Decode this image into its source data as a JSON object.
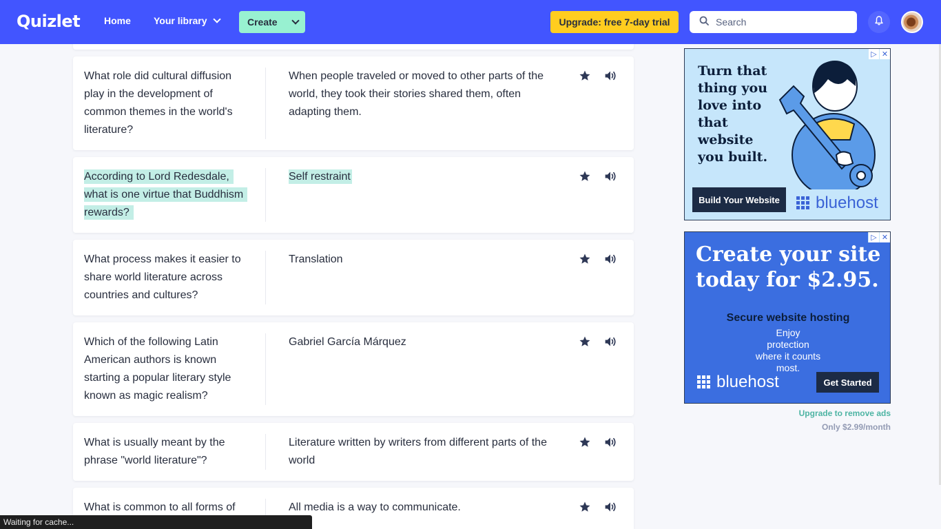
{
  "nav": {
    "logo": "Quizlet",
    "home": "Home",
    "library": "Your library",
    "create": "Create",
    "upgrade": "Upgrade: free 7-day trial",
    "search_placeholder": "Search",
    "icons": [
      "search-icon",
      "bell-icon",
      "chevron-down-icon"
    ]
  },
  "cards": [
    {
      "term": "What role did cultural diffusion play in the development of common themes in the world's literature?",
      "definition": "When people traveled or moved to other parts of the world, they took their stories shared them, often adapting them.",
      "highlighted": false
    },
    {
      "term": "According to Lord Redesdale, what is one virtue that Buddhism rewards?",
      "definition": "Self restraint",
      "highlighted": true
    },
    {
      "term": "What process makes it easier to share world literature across countries and cultures?",
      "definition": "Translation",
      "highlighted": false
    },
    {
      "term": "Which of the following Latin American authors is known starting a popular literary style known as magic realism?",
      "definition": "Gabriel García Márquez",
      "highlighted": false
    },
    {
      "term": "What is usually meant by the phrase \"world literature\"?",
      "definition": "Literature written by writers from different parts of the world",
      "highlighted": false
    },
    {
      "term": "What is common to all forms of",
      "definition": "All media is a way to communicate.",
      "highlighted": false
    }
  ],
  "ads": {
    "ad1": {
      "headline": "Turn that thing you love into that website you built.",
      "button": "Build Your Website",
      "brand": "bluehost"
    },
    "ad2": {
      "headline": "Create your site today for $2.95.",
      "subhead": "Secure website hosting",
      "body": "Enjoy protection where it counts most.",
      "brand": "bluehost",
      "button": "Get Started"
    },
    "remove_link": "Upgrade to remove ads",
    "remove_price": "Only $2.99/month"
  },
  "status": "Waiting for cache...",
  "colors": {
    "nav": "#4255ff",
    "create": "#98f1d1",
    "upgrade": "#ffcd1f",
    "highlight": "#c3eee6",
    "accent_link": "#4db4a3"
  }
}
